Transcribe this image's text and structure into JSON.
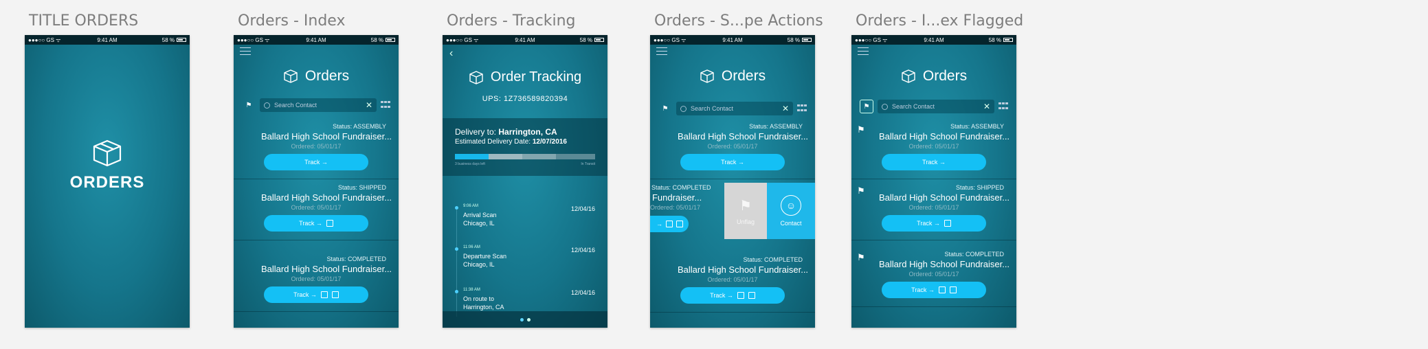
{
  "status_bar": {
    "carrier": "●●●○○ GS ᯤ",
    "time": "9:41 AM",
    "battery": "58 %"
  },
  "boards": [
    {
      "title": "TITLE ORDERS"
    },
    {
      "title": "Orders - Index"
    },
    {
      "title": "Orders - Tracking"
    },
    {
      "title": "Orders - S...pe Actions"
    },
    {
      "title": "Orders - I...ex Flagged"
    }
  ],
  "splash": {
    "brand": "ORDERS"
  },
  "orders_header": "Orders",
  "search_placeholder": "Search Contact",
  "clear_glyph": "✕",
  "flag_glyph": "⚑",
  "orders": [
    {
      "status": "Status: ASSEMBLY",
      "name": "Ballard High School Fundraiser...",
      "date": "Ordered: 05/01/17",
      "track": "Track →",
      "boxes": 0
    },
    {
      "status": "Status: SHIPPED",
      "name": "Ballard High School Fundraiser...",
      "date": "Ordered: 05/01/17",
      "track": "Track →",
      "boxes": 1
    },
    {
      "status": "Status: COMPLETED",
      "name": "Ballard High School Fundraiser...",
      "date": "Ordered: 05/01/17",
      "track": "Track →",
      "boxes": 2
    }
  ],
  "tracking": {
    "title": "Order Tracking",
    "ups": "UPS: 1Z736589820394",
    "delivery_prefix": "Delivery to:",
    "delivery_city": "Harrington, CA",
    "eta_prefix": "Estimated Delivery Date:",
    "eta_date": "12/07/2016",
    "progress_segments": [
      {
        "color": "#17b8ec",
        "fraction": 0.24
      },
      {
        "color": "#9fb9c0",
        "fraction": 0.24
      },
      {
        "color": "#82a6af",
        "fraction": 0.24
      },
      {
        "color": "#5b8a96",
        "fraction": 0.28
      }
    ],
    "foot_left": "3 business days left",
    "foot_right": "In Transit",
    "events": [
      {
        "time": "9:06 AM",
        "line1": "Arrival Scan",
        "line2": "Chicago, IL",
        "date": "12/04/16"
      },
      {
        "time": "11:06 AM",
        "line1": "Departure Scan",
        "line2": "Chicago, IL",
        "date": "12/04/16"
      },
      {
        "time": "11:38 AM",
        "line1": "On route to",
        "line2": "Harrington, CA",
        "date": "12/04/16"
      }
    ]
  },
  "swipe": {
    "status": "Status: COMPLETED",
    "name": "ool Fundraiser...",
    "date": "Ordered: 05/01/17",
    "unflag_label": "Unflag",
    "contact_label": "Contact",
    "person_glyph": "☺"
  },
  "colors": {
    "accent": "#14c0f5",
    "bg": "#15758b",
    "status_bar": "#05242c"
  }
}
